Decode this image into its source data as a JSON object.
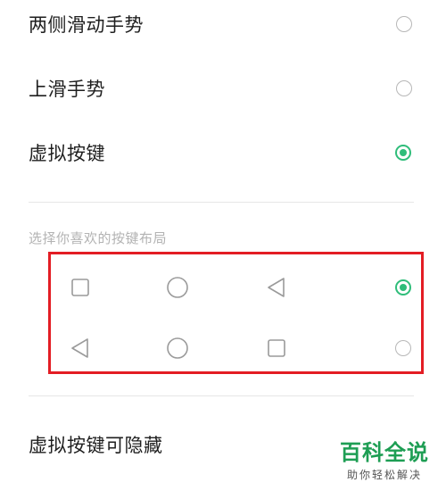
{
  "options": [
    {
      "label": "两侧滑动手势",
      "checked": false
    },
    {
      "label": "上滑手势",
      "checked": false
    },
    {
      "label": "虚拟按键",
      "checked": true
    }
  ],
  "layouts": {
    "caption": "选择你喜欢的按键布局",
    "rows": [
      {
        "icons": [
          "square-icon",
          "circle-icon",
          "back-triangle-icon"
        ],
        "checked": true
      },
      {
        "icons": [
          "back-triangle-icon",
          "circle-icon",
          "square-icon"
        ],
        "checked": false
      }
    ]
  },
  "hideable": {
    "label": "虚拟按键可隐藏"
  },
  "watermark": {
    "title": "百科全说",
    "subtitle": "助你轻松解决"
  },
  "colors": {
    "accent": "#2fbd7a",
    "highlight_border": "#e31d24",
    "divider": "#e6e6e6",
    "caption": "#b3b3b3"
  }
}
